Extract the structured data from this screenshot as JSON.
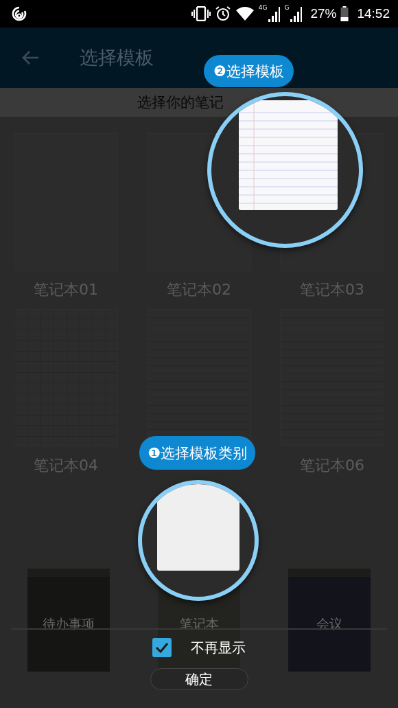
{
  "status_bar": {
    "network_labels": [
      "4G",
      "G"
    ],
    "battery": "27%",
    "time": "14:52"
  },
  "app_bar": {
    "title": "选择模板"
  },
  "subtitle": "选择你的笔记",
  "templates": [
    {
      "label": "笔记本01",
      "kind": "plain"
    },
    {
      "label": "笔记本02",
      "kind": "plain"
    },
    {
      "label": "笔记本03",
      "kind": "plain"
    },
    {
      "label": "笔记本04",
      "kind": "grid"
    },
    {
      "kind": "lined"
    },
    {
      "label": "笔记本06",
      "kind": "lined"
    }
  ],
  "categories": [
    {
      "label": "待办事项",
      "color": "#151513"
    },
    {
      "label": "笔记本",
      "color": "#23231f"
    },
    {
      "label": "会议",
      "color": "#13141b"
    }
  ],
  "dont_show_again": {
    "label": "不再显示",
    "checked": true
  },
  "confirm_button": "确定",
  "guide": [
    {
      "step": "❷选择模板",
      "kind": "lined"
    },
    {
      "step": "❶选择模板类别",
      "kind": "blank"
    }
  ]
}
